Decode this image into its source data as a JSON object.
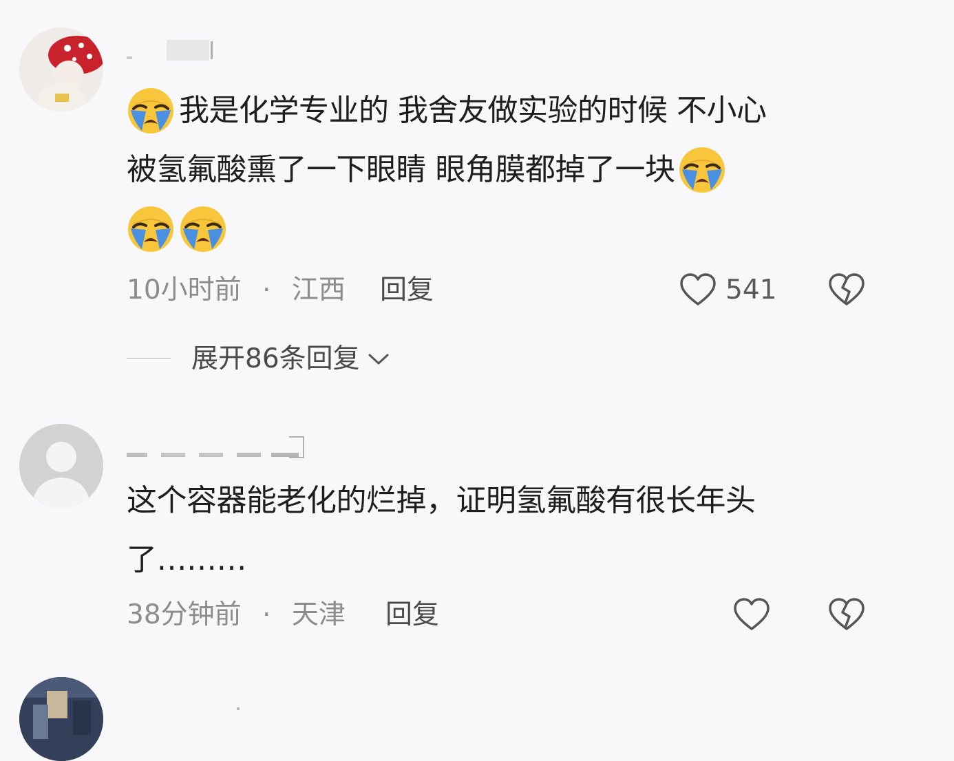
{
  "comments": [
    {
      "text_line1": "我是化学专业的 我舍友做实验的时候 不小心",
      "text_line2": "被氢氟酸熏了一下眼睛 眼角膜都掉了一块",
      "time": "10小时前",
      "separator": "·",
      "location": "江西",
      "reply_label": "回复",
      "like_count": "541"
    },
    {
      "text_line1": "这个容器能老化的烂掉，证明氢氟酸有很长年头",
      "text_line2": "了………",
      "time": "38分钟前",
      "separator": "·",
      "location": "天津",
      "reply_label": "回复"
    }
  ],
  "expand_replies": "展开86条回复",
  "icons": {
    "emoji": "loudly-crying-face-emoji",
    "like": "heart-outline-icon",
    "dislike": "broken-heart-icon",
    "expand": "chevron-down-icon"
  },
  "colors": {
    "emoji_face": "#f7c63a",
    "emoji_tears": "#4a90e2",
    "meta_text": "#8c8c8c",
    "icon": "#555555"
  }
}
